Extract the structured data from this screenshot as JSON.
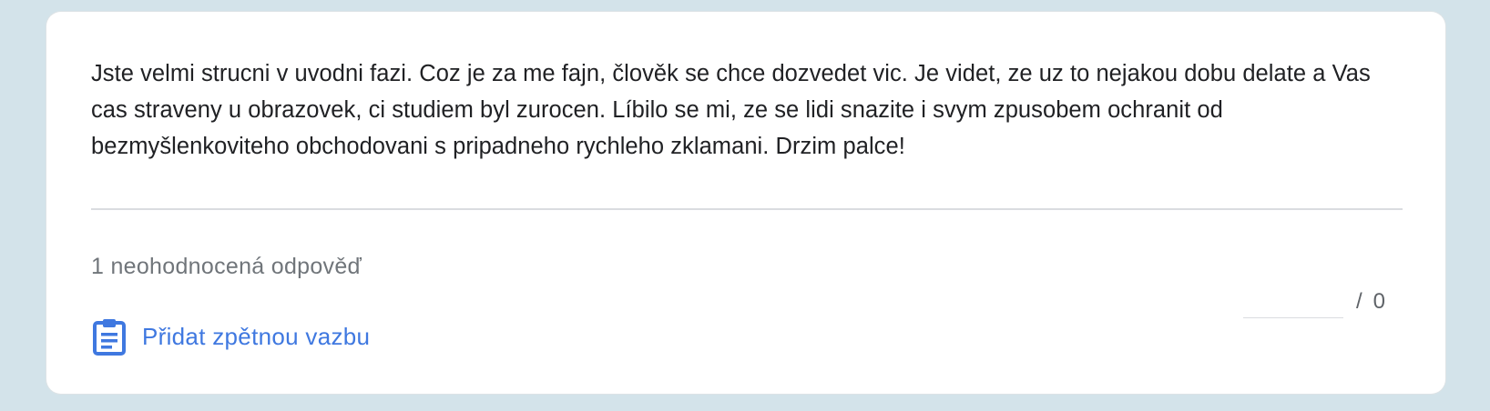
{
  "response": {
    "text": "Jste velmi strucni v uvodni fazi. Coz je za me fajn, člověk se chce dozvedet vic. Je videt, ze uz to nejakou dobu delate a Vas cas straveny u obrazovek, ci studiem byl zurocen. Líbilo se mi, ze se lidi snazite i svym zpusobem ochranit od bezmyšlenkoviteho obchodovani s pripadneho rychleho zklamani. Drzim palce!"
  },
  "grading": {
    "ungraded_label": "1 neohodnocená odpověď",
    "score_value": "",
    "score_separator": "/",
    "score_max": "0"
  },
  "feedback": {
    "label": "Přidat zpětnou vazbu",
    "icon": "clipboard-icon"
  },
  "colors": {
    "page_background": "#d3e3ea",
    "card_background": "#ffffff",
    "accent": "#3f78e0",
    "text_primary": "#202124",
    "text_secondary": "#70757a"
  }
}
